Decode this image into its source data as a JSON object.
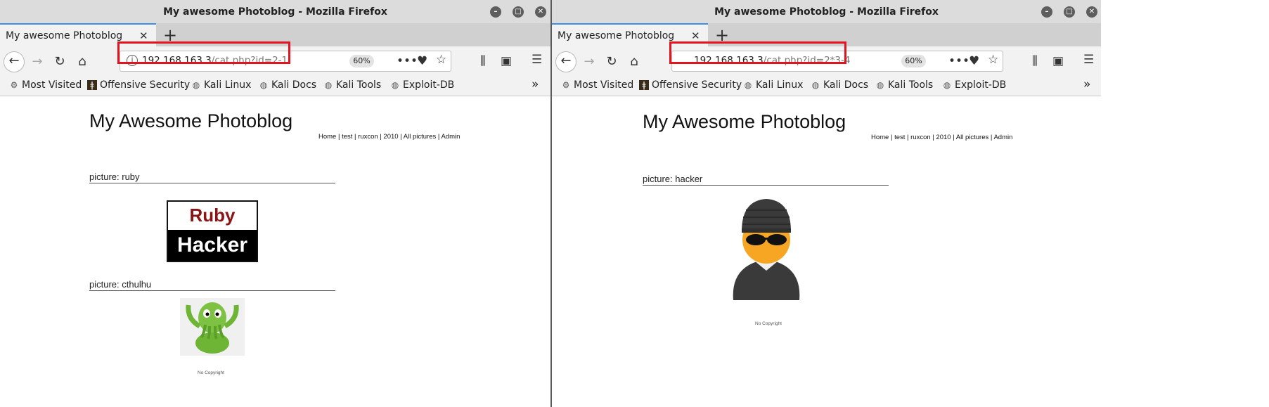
{
  "left": {
    "window_title": "My awesome Photoblog - Mozilla Firefox",
    "tab_title": "My awesome Photoblog",
    "url_host": "192.168.163.3",
    "url_path": "/cat.php?id=2-1",
    "zoom": "60%",
    "bookmarks": [
      "Most Visited",
      "Offensive Security",
      "Kali Linux",
      "Kali Docs",
      "Kali Tools",
      "Exploit-DB"
    ],
    "page_title": "My Awesome Photoblog",
    "nav": "Home | test | ruxcon | 2010 | All pictures | Admin",
    "pictures": [
      {
        "label": "picture: ruby",
        "image_text_top": "Ruby",
        "image_text_bottom": "Hacker"
      },
      {
        "label": "picture: cthulhu"
      }
    ],
    "footer": "No Copyright"
  },
  "right": {
    "window_title": "My awesome Photoblog - Mozilla Firefox",
    "tab_title": "My awesome Photoblog",
    "url_host": "192.168.163.3",
    "url_path": "/cat.php?id=2*3-4",
    "zoom": "60%",
    "bookmarks": [
      "Most Visited",
      "Offensive Security",
      "Kali Linux",
      "Kali Docs",
      "Kali Tools",
      "Exploit-DB"
    ],
    "page_title": "My Awesome Photoblog",
    "nav": "Home | test | ruxcon | 2010 | All pictures | Admin",
    "pictures": [
      {
        "label": "picture: hacker"
      }
    ],
    "footer": "No Copyright"
  },
  "colors": {
    "highlight": "#e3131f",
    "ruby_red": "#8b1414",
    "cthulhu_green": "#7dc242"
  }
}
